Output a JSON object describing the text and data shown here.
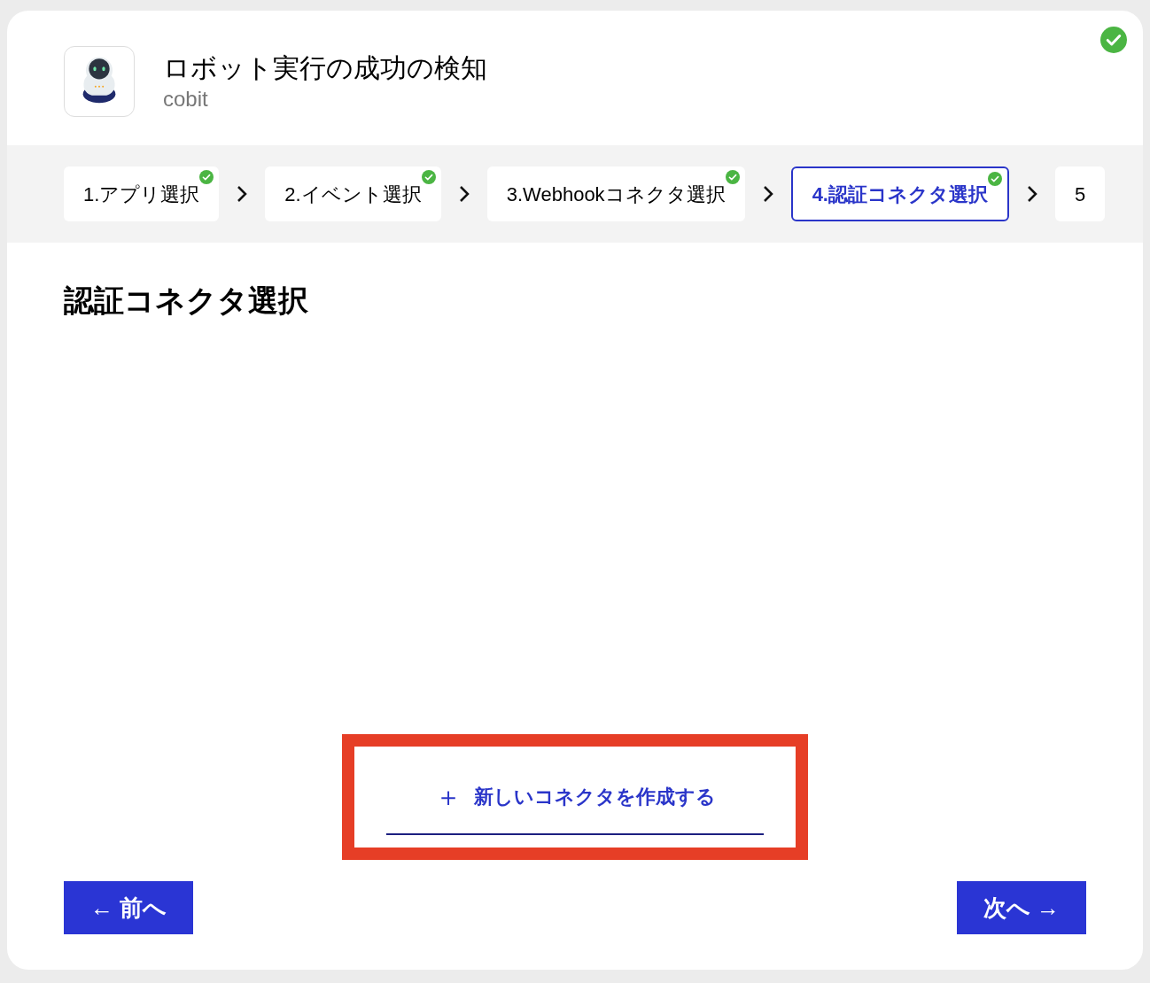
{
  "header": {
    "title": "ロボット実行の成功の検知",
    "subtitle": "cobit",
    "completed": true
  },
  "steps": [
    {
      "label": "1.アプリ選択",
      "completed": true,
      "selected": false
    },
    {
      "label": "2.イベント選択",
      "completed": true,
      "selected": false
    },
    {
      "label": "3.Webhookコネクタ選択",
      "completed": true,
      "selected": false
    },
    {
      "label": "4.認証コネクタ選択",
      "completed": true,
      "selected": true
    },
    {
      "label": "5",
      "completed": false,
      "selected": false
    }
  ],
  "section_title": "認証コネクタ選択",
  "create_button": {
    "icon": "＋",
    "label": "新しいコネクタを作成する",
    "highlighted": true
  },
  "nav": {
    "prev": "← 前へ",
    "next": "次へ →"
  }
}
